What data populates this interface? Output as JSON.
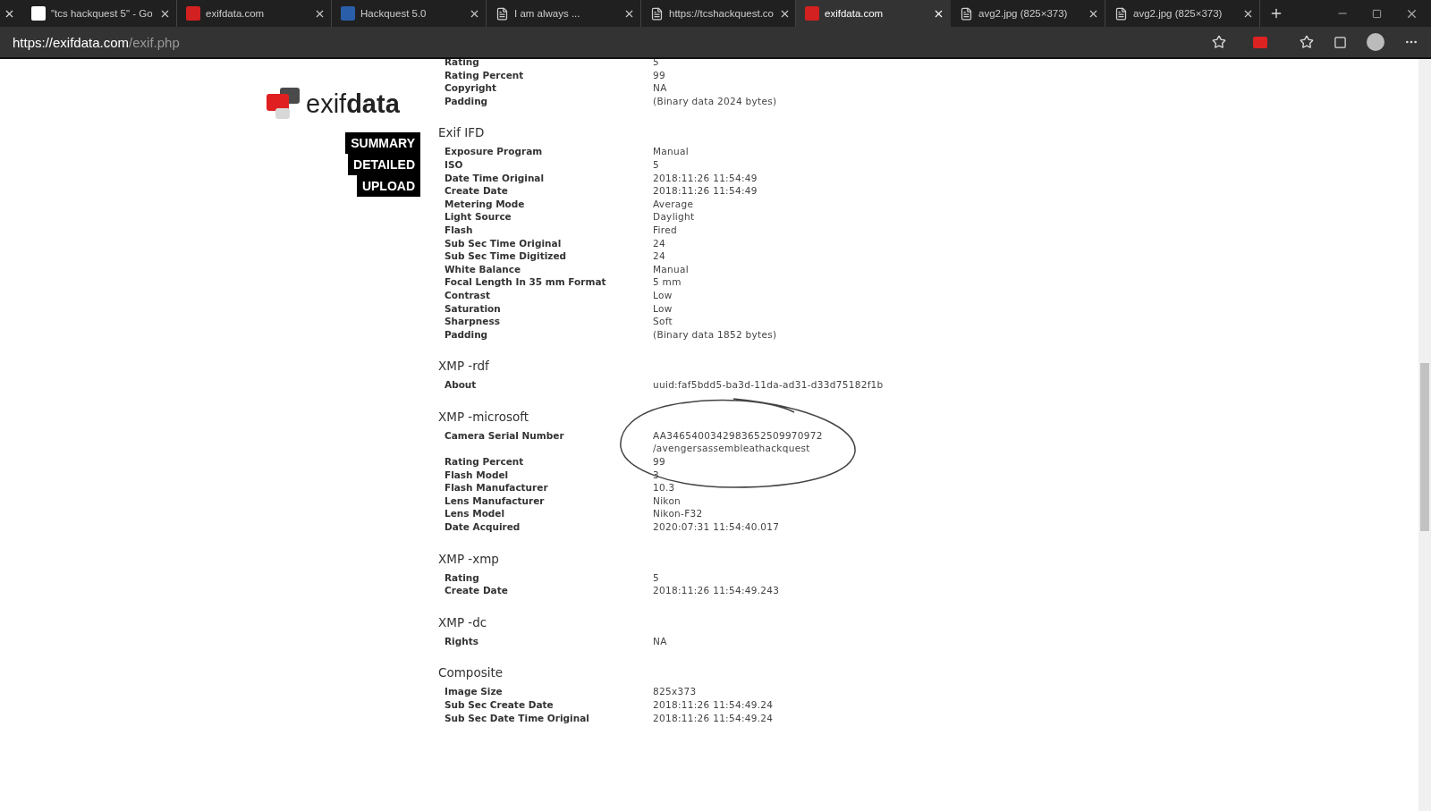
{
  "tabs": [
    {
      "title": "\"tcs hackquest 5\" - Go",
      "kind": "google",
      "selected": false
    },
    {
      "title": "exifdata.com",
      "kind": "exif",
      "selected": false
    },
    {
      "title": "Hackquest 5.0",
      "kind": "tata",
      "selected": false
    },
    {
      "title": "I am always ...",
      "kind": "page",
      "selected": false
    },
    {
      "title": "https://tcshackquest.co",
      "kind": "page",
      "selected": false
    },
    {
      "title": "exifdata.com",
      "kind": "exif",
      "selected": true
    },
    {
      "title": "avg2.jpg (825×373)",
      "kind": "page",
      "selected": false
    },
    {
      "title": "avg2.jpg (825×373)",
      "kind": "page",
      "selected": false
    }
  ],
  "address": {
    "host": "https://exifdata.com",
    "path": "/exif.php"
  },
  "logo": "exif**data**",
  "nav": [
    "SUMMARY",
    "DETAILED",
    "UPLOAD"
  ],
  "sections": [
    {
      "rows": [
        [
          "Rating",
          "5"
        ],
        [
          "Rating Percent",
          "99"
        ],
        [
          "Copyright",
          "NA"
        ],
        [
          "Padding",
          "(Binary data 2024 bytes)"
        ]
      ]
    },
    {
      "heading": "Exif IFD",
      "rows": [
        [
          "Exposure Program",
          "Manual"
        ],
        [
          "ISO",
          "5"
        ],
        [
          "Date Time Original",
          "2018:11:26 11:54:49"
        ],
        [
          "Create Date",
          "2018:11:26 11:54:49"
        ],
        [
          "Metering Mode",
          "Average"
        ],
        [
          "Light Source",
          "Daylight"
        ],
        [
          "Flash",
          "Fired"
        ],
        [
          "Sub Sec Time Original",
          "24"
        ],
        [
          "Sub Sec Time Digitized",
          "24"
        ],
        [
          "White Balance",
          "Manual"
        ],
        [
          "Focal Length In 35 mm Format",
          "5 mm"
        ],
        [
          "Contrast",
          "Low"
        ],
        [
          "Saturation",
          "Low"
        ],
        [
          "Sharpness",
          "Soft"
        ],
        [
          "Padding",
          "(Binary data 1852 bytes)"
        ]
      ]
    },
    {
      "heading": "XMP -rdf",
      "rows": [
        [
          "About",
          "uuid:faf5bdd5-ba3d-11da-ad31-d33d75182f1b"
        ]
      ]
    },
    {
      "heading": "XMP -microsoft",
      "rows": [
        [
          "Camera Serial Number",
          "AA3465400342983652509970972\n/avengersassembleathackquest"
        ],
        [
          "Rating Percent",
          "99"
        ],
        [
          "Flash Model",
          "3"
        ],
        [
          "Flash Manufacturer",
          "10.3"
        ],
        [
          "Lens Manufacturer",
          "Nikon"
        ],
        [
          "Lens Model",
          "Nikon-F32"
        ],
        [
          "Date Acquired",
          "2020:07:31 11:54:40.017"
        ]
      ]
    },
    {
      "heading": "XMP -xmp",
      "rows": [
        [
          "Rating",
          "5"
        ],
        [
          "Create Date",
          "2018:11:26 11:54:49.243"
        ]
      ]
    },
    {
      "heading": "XMP -dc",
      "rows": [
        [
          "Rights",
          "NA"
        ]
      ]
    },
    {
      "heading": "Composite",
      "rows": [
        [
          "Image Size",
          "825x373"
        ],
        [
          "Sub Sec Create Date",
          "2018:11:26 11:54:49.24"
        ],
        [
          "Sub Sec Date Time Original",
          "2018:11:26 11:54:49.24"
        ]
      ]
    }
  ]
}
